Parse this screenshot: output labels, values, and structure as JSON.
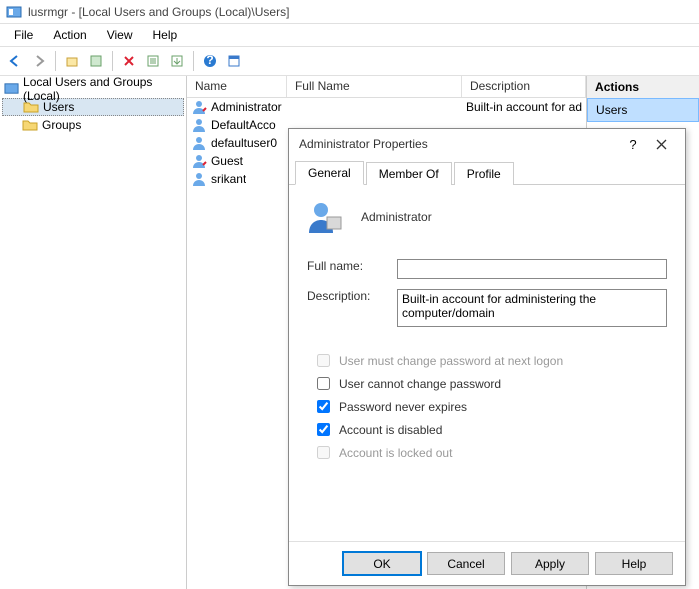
{
  "window": {
    "title": "lusrmgr - [Local Users and Groups (Local)\\Users]"
  },
  "menu": {
    "file": "File",
    "action": "Action",
    "view": "View",
    "help": "Help"
  },
  "tree": {
    "root": "Local Users and Groups (Local)",
    "users": "Users",
    "groups": "Groups"
  },
  "list": {
    "cols": {
      "name": "Name",
      "fullname": "Full Name",
      "desc": "Description"
    },
    "rows": [
      {
        "name": "Administrator",
        "fullname": "",
        "desc": "Built-in account for ad"
      },
      {
        "name": "DefaultAcco",
        "fullname": "",
        "desc": ""
      },
      {
        "name": "defaultuser0",
        "fullname": "",
        "desc": ""
      },
      {
        "name": "Guest",
        "fullname": "",
        "desc": ""
      },
      {
        "name": "srikant",
        "fullname": "",
        "desc": ""
      }
    ]
  },
  "actions": {
    "header": "Actions",
    "context": "Users"
  },
  "dialog": {
    "title": "Administrator Properties",
    "help": "?",
    "tabs": {
      "general": "General",
      "memberof": "Member Of",
      "profile": "Profile"
    },
    "username": "Administrator",
    "labels": {
      "fullname": "Full name:",
      "description": "Description:"
    },
    "fields": {
      "fullname": "",
      "description": "Built-in account for administering the computer/domain"
    },
    "checks": {
      "mustchange": "User must change password at next logon",
      "cannotchange": "User cannot change password",
      "neverexpires": "Password never expires",
      "disabled": "Account is disabled",
      "lockedout": "Account is locked out"
    },
    "buttons": {
      "ok": "OK",
      "cancel": "Cancel",
      "apply": "Apply",
      "help": "Help"
    }
  }
}
